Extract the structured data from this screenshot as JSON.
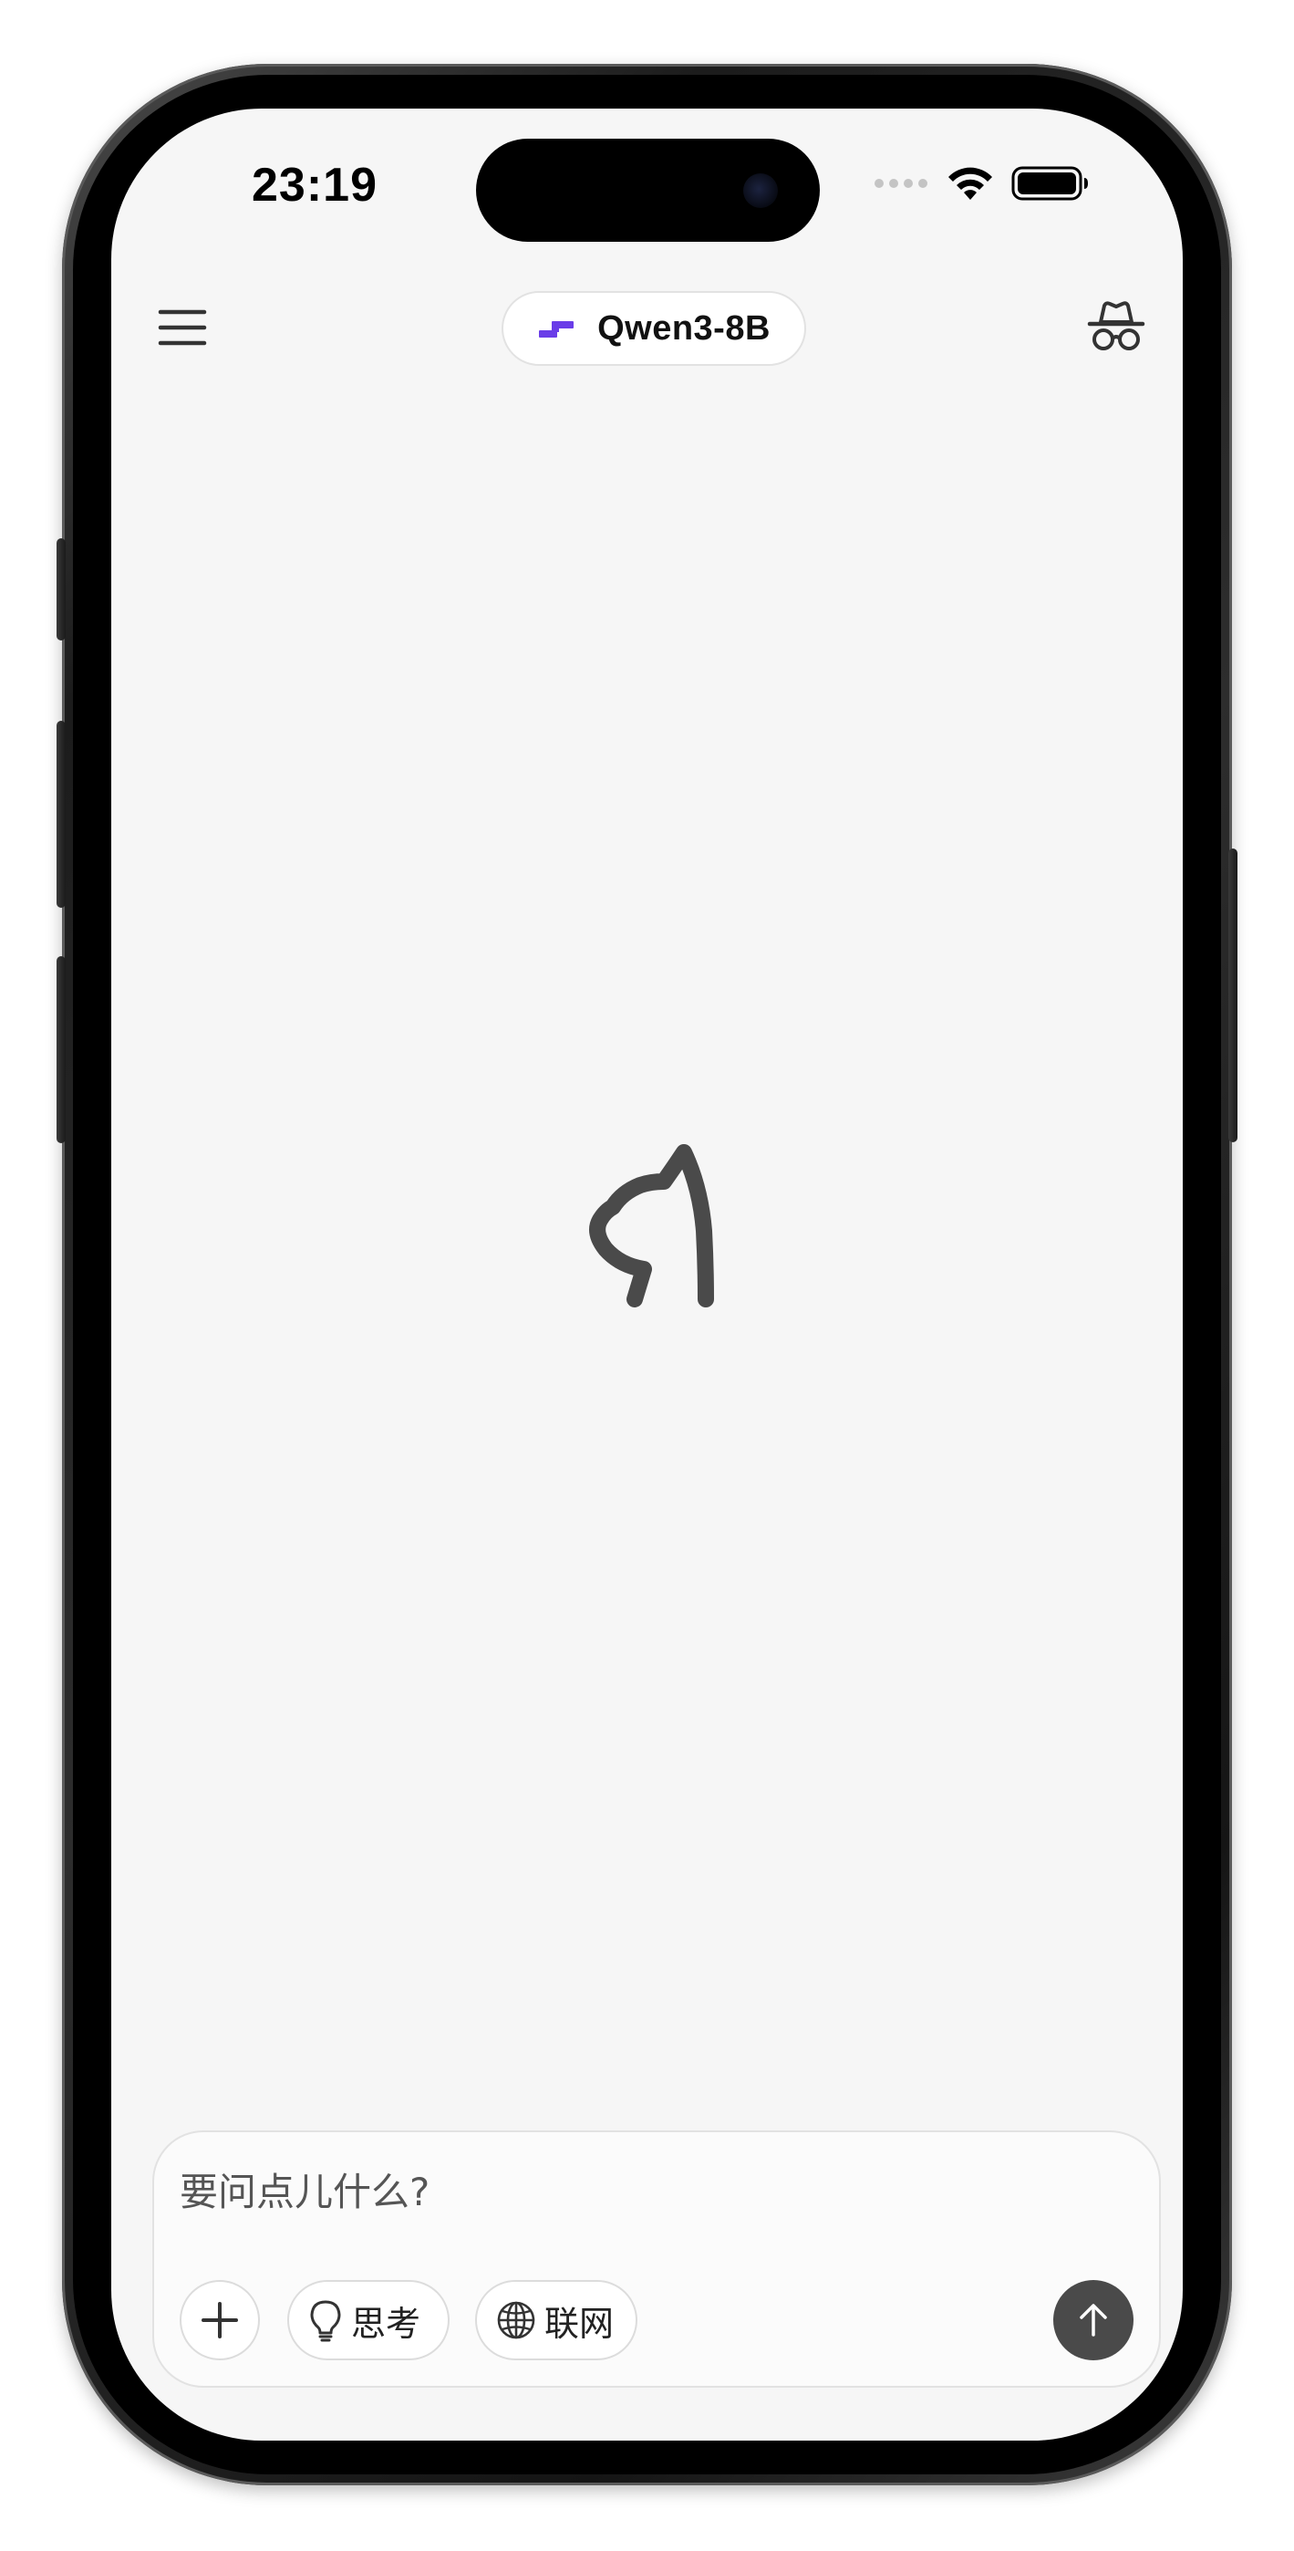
{
  "status_bar": {
    "time": "23:19",
    "wifi_icon": "wifi-icon",
    "battery_icon": "battery-icon",
    "signal_icon": "signal-dots-icon"
  },
  "header": {
    "menu_icon": "hamburger-menu-icon",
    "model_name": "Qwen3-8B",
    "model_icon": "qwen-logo-icon",
    "model_icon_color": "#6a3de8",
    "incognito_icon": "incognito-icon"
  },
  "main": {
    "logo_icon": "cat-logo-icon"
  },
  "composer": {
    "placeholder": "要问点儿什么?",
    "value": "",
    "add_icon": "plus-icon",
    "think_label": "思考",
    "think_icon": "lightbulb-icon",
    "web_label": "联网",
    "web_icon": "globe-icon",
    "send_icon": "arrow-up-icon"
  },
  "colors": {
    "screen_bg": "#f6f6f6",
    "send_button": "#4a4a4a",
    "accent": "#6a3de8"
  }
}
